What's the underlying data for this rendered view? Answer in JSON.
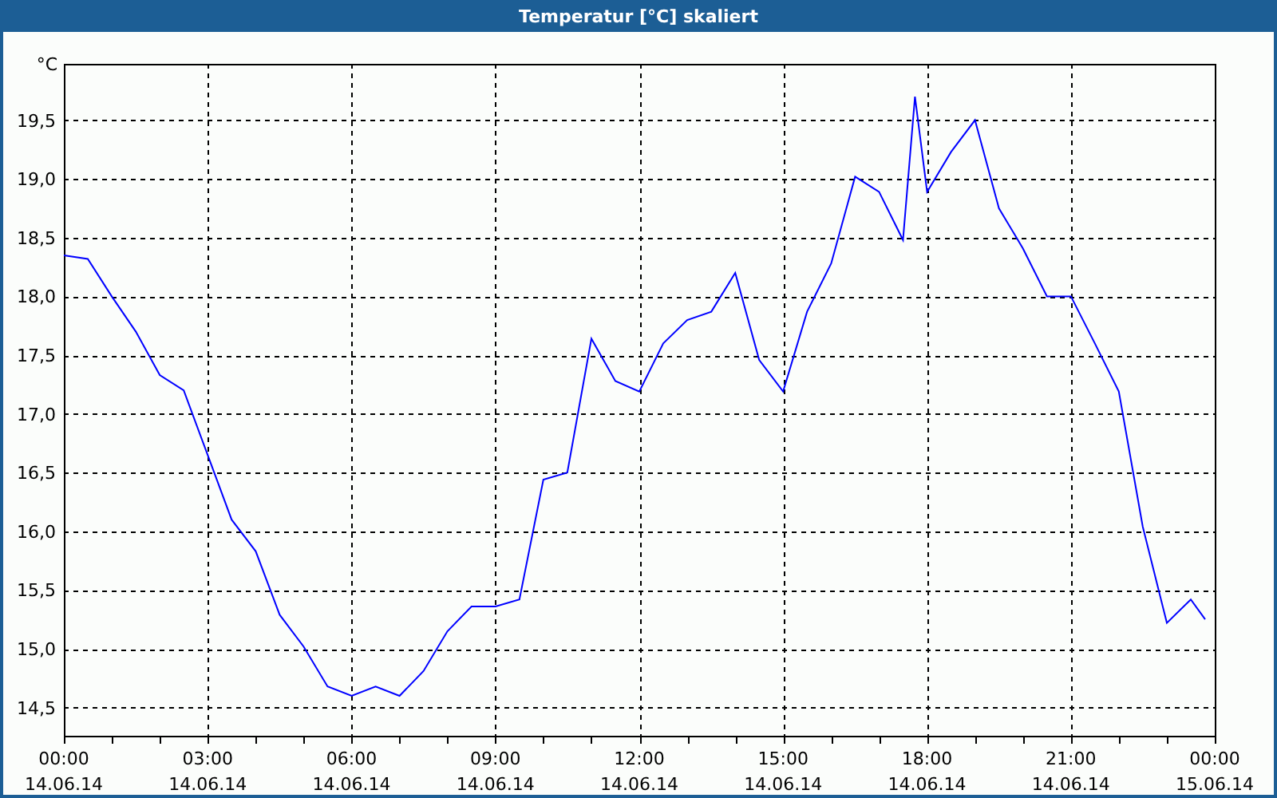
{
  "window": {
    "title": "Temperatur [°C] skaliert"
  },
  "chart": {
    "chart_data": {
      "type": "line",
      "ylabel": "°C",
      "x": [
        0,
        0.5,
        1,
        1.5,
        2,
        2.5,
        3,
        3.5,
        4,
        4.5,
        5,
        5.5,
        6,
        6.5,
        7,
        7.5,
        8,
        8.5,
        9,
        9.5,
        10,
        10.5,
        11,
        11.5,
        12,
        12.5,
        13,
        13.5,
        14,
        14.5,
        15,
        15.5,
        16,
        16.5,
        17,
        17.5,
        17.75,
        18,
        18.5,
        19,
        19.5,
        20,
        20.5,
        21,
        21.5,
        22,
        22.5,
        23,
        23.5,
        23.8
      ],
      "series": [
        {
          "color": "#0000ff",
          "values": [
            18.35,
            18.32,
            18.0,
            17.7,
            17.33,
            17.2,
            16.65,
            16.1,
            15.83,
            15.29,
            15.02,
            14.68,
            14.6,
            14.68,
            14.6,
            14.81,
            15.15,
            15.36,
            15.36,
            15.42,
            16.44,
            16.5,
            17.64,
            17.28,
            17.19,
            17.6,
            17.8,
            17.87,
            18.2,
            17.46,
            17.19,
            17.87,
            18.28,
            19.02,
            18.89,
            18.48,
            19.7,
            18.89,
            19.23,
            19.5,
            18.75,
            18.41,
            18.0,
            18.0,
            17.6,
            17.19,
            16.04,
            15.22,
            15.42,
            15.25
          ]
        }
      ],
      "grid": true,
      "xlim": [
        0,
        24
      ],
      "ylim": [
        14.26,
        19.98
      ],
      "xticks": [
        {
          "value": 0,
          "label": "00:00"
        },
        {
          "value": 3,
          "label": "03:00"
        },
        {
          "value": 6,
          "label": "06:00"
        },
        {
          "value": 9,
          "label": "09:00"
        },
        {
          "value": 12,
          "label": "12:00"
        },
        {
          "value": 15,
          "label": "15:00"
        },
        {
          "value": 18,
          "label": "18:00"
        },
        {
          "value": 21,
          "label": "21:00"
        },
        {
          "value": 24,
          "label": "00:00"
        }
      ],
      "yticks": [
        {
          "value": 14.5,
          "label": "14,5"
        },
        {
          "value": 15,
          "label": "15,0"
        },
        {
          "value": 15.5,
          "label": "15,5"
        },
        {
          "value": 16,
          "label": "16,0"
        },
        {
          "value": 16.5,
          "label": "16,5"
        },
        {
          "value": 17,
          "label": "17,0"
        },
        {
          "value": 17.5,
          "label": "17,5"
        },
        {
          "value": 18,
          "label": "18,0"
        },
        {
          "value": 18.5,
          "label": "18,5"
        },
        {
          "value": 19,
          "label": "19,0"
        },
        {
          "value": 19.5,
          "label": "19,5"
        }
      ]
    },
    "date_labels": [
      "14.06.14",
      "14.06.14",
      "14.06.14",
      "14.06.14",
      "14.06.14",
      "14.06.14",
      "14.06.14",
      "14.06.14",
      "15.06.14"
    ]
  }
}
